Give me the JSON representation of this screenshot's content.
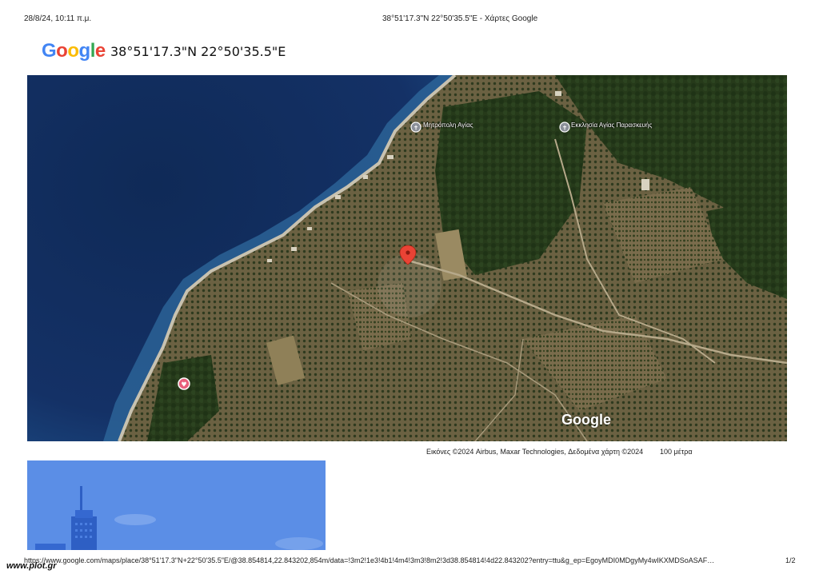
{
  "print_header": {
    "date": "28/8/24, 10:11 π.μ.",
    "title": "38°51'17.3\"N 22°50'35.5\"E - Χάρτες Google"
  },
  "logo": {
    "letters": [
      "G",
      "o",
      "o",
      "g",
      "l",
      "e"
    ],
    "colors": [
      "#4285F4",
      "#EA4335",
      "#FBBC05",
      "#4285F4",
      "#34A853",
      "#EA4335"
    ]
  },
  "coordinates": "38°51'17.3\"N 22°50'35.5\"E",
  "map": {
    "view": "satellite",
    "poi_labels": [
      "Μητρόπολη Αγίας",
      "Εκκλησία Αγίας Παρασκευής"
    ],
    "watermark": "Google",
    "pin_color": "#EA4335"
  },
  "attribution": "Εικόνες ©2024 Airbus, Maxar Technologies, Δεδομένα χάρτη ©2024",
  "scale_label": "100 μέτρα",
  "footer": {
    "url": "https://www.google.com/maps/place/38°51'17.3\"N+22°50'35.5\"E/@38.854814,22.843202,854m/data=!3m2!1e3!4b1!4m4!3m3!8m2!3d38.854814!4d22.843202?entry=ttu&g_ep=EgoyMDI0MDgyMy4wIKXMDSoASAF…",
    "page": "1/2"
  },
  "site_stamp": "www.plot.gr"
}
